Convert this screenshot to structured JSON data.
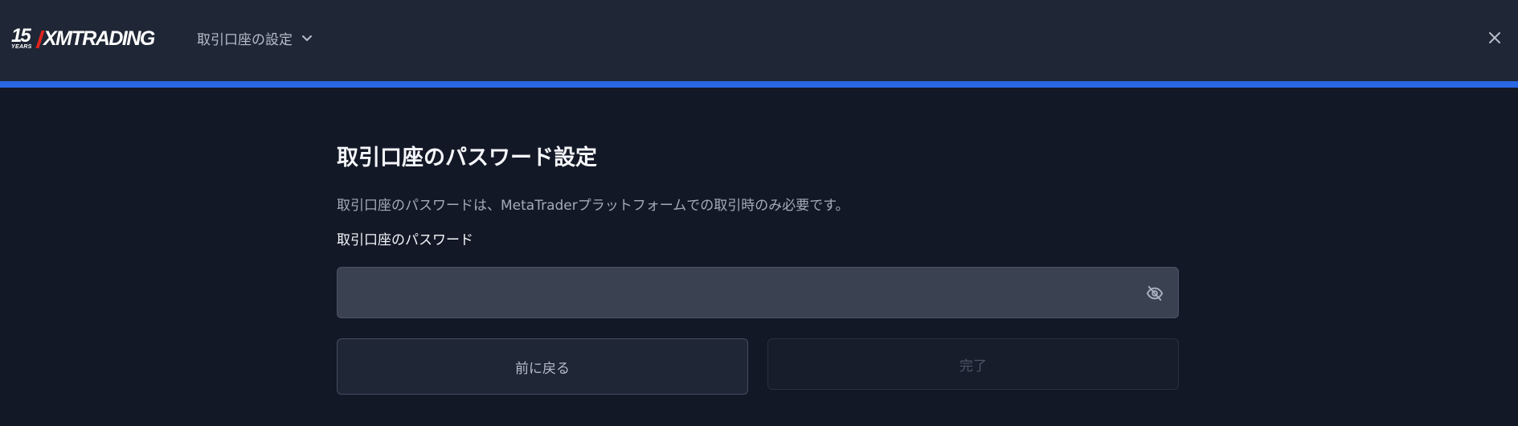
{
  "header": {
    "logo": {
      "years_number": "15",
      "years_text": "YEARS",
      "brand": "XMTRADING"
    },
    "nav_title": "取引口座の設定",
    "nav_icon": "chevron-down-icon",
    "close_icon": "close-icon"
  },
  "progress": {
    "fraction": 1.0,
    "color": "#2a67e3"
  },
  "main": {
    "title": "取引口座のパスワード設定",
    "description": "取引口座のパスワードは、MetaTraderプラットフォームでの取引時のみ必要です。",
    "password_field": {
      "label": "取引口座のパスワード",
      "value": "",
      "placeholder": "",
      "toggle_icon": "eye-off-icon"
    },
    "buttons": {
      "back_label": "前に戻る",
      "done_label": "完了"
    }
  },
  "colors": {
    "background": "#131826",
    "header": "#1f2635",
    "accent": "#2a67e3",
    "logo_accent": "#e0231e"
  }
}
